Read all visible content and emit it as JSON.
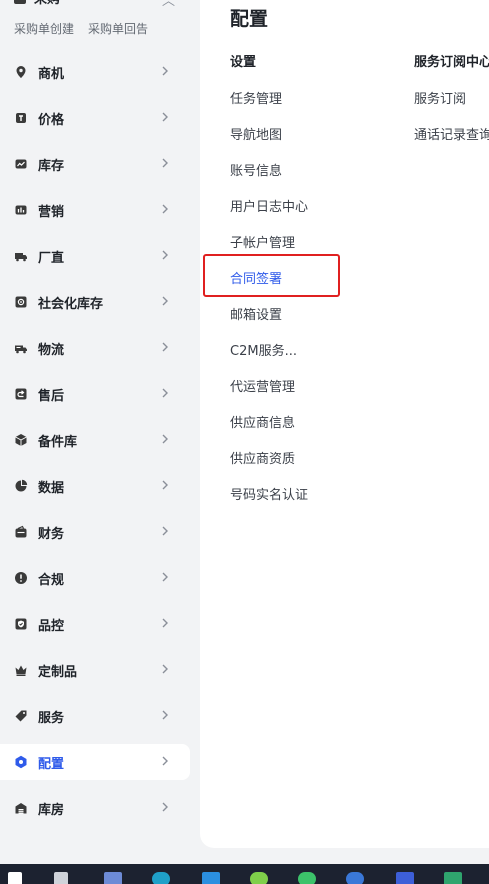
{
  "sidebar": {
    "top_partial_label": "采购",
    "sub_links": [
      "采购单创建",
      "采购单回告"
    ],
    "items": [
      {
        "label": "商机",
        "icon": "location-pin-icon"
      },
      {
        "label": "价格",
        "icon": "price-tag-icon"
      },
      {
        "label": "库存",
        "icon": "stock-chart-icon"
      },
      {
        "label": "营销",
        "icon": "marketing-bars-icon"
      },
      {
        "label": "厂直",
        "icon": "truck-icon"
      },
      {
        "label": "社会化库存",
        "icon": "target-icon"
      },
      {
        "label": "物流",
        "icon": "delivery-truck-icon"
      },
      {
        "label": "售后",
        "icon": "return-icon"
      },
      {
        "label": "备件库",
        "icon": "cube-icon"
      },
      {
        "label": "数据",
        "icon": "pie-chart-icon"
      },
      {
        "label": "财务",
        "icon": "wallet-icon"
      },
      {
        "label": "合规",
        "icon": "alert-icon"
      },
      {
        "label": "品控",
        "icon": "shield-icon"
      },
      {
        "label": "定制品",
        "icon": "crown-icon"
      },
      {
        "label": "服务",
        "icon": "service-tag-icon"
      },
      {
        "label": "配置",
        "icon": "hexagon-settings-icon",
        "active": true
      },
      {
        "label": "库房",
        "icon": "warehouse-icon"
      }
    ]
  },
  "main": {
    "title": "配置",
    "columns": [
      {
        "header": "设置",
        "links": [
          "任务管理",
          "导航地图",
          "账号信息",
          "用户日志中心",
          "子帐户管理",
          "合同签署",
          "邮箱设置",
          "C2M服务...",
          "代运营管理",
          "供应商信息",
          "供应商资质",
          "号码实名认证"
        ],
        "highlighted_link": "合同签署"
      },
      {
        "header": "服务订阅中心",
        "links": [
          "服务订阅",
          "通话记录查询"
        ]
      }
    ]
  },
  "colors": {
    "accent": "#2f5bea",
    "highlight_box": "#e02020",
    "sidebar_bg": "#f2f3f5",
    "panel_bg": "#ffffff"
  }
}
